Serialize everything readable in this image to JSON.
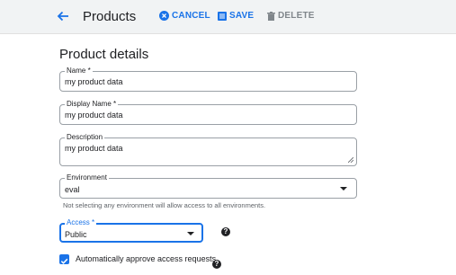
{
  "header": {
    "title": "Products",
    "cancel_label": "CANCEL",
    "save_label": "SAVE",
    "delete_label": "DELETE"
  },
  "form": {
    "section_title": "Product details",
    "name": {
      "label": "Name *",
      "value": "my product data"
    },
    "display_name": {
      "label": "Display Name *",
      "value": "my product data"
    },
    "description": {
      "label": "Description",
      "value": "my product data"
    },
    "environment": {
      "label": "Environment",
      "value": "eval",
      "hint": "Not selecting any environment will allow access to all environments."
    },
    "access": {
      "label": "Access *",
      "value": "Public"
    },
    "auto_approve": {
      "label": "Automatically approve access requests",
      "checked": true
    }
  },
  "colors": {
    "accent": "#1a73e8",
    "toolbar_bg": "#f1f3f4",
    "disabled": "#80868b"
  }
}
